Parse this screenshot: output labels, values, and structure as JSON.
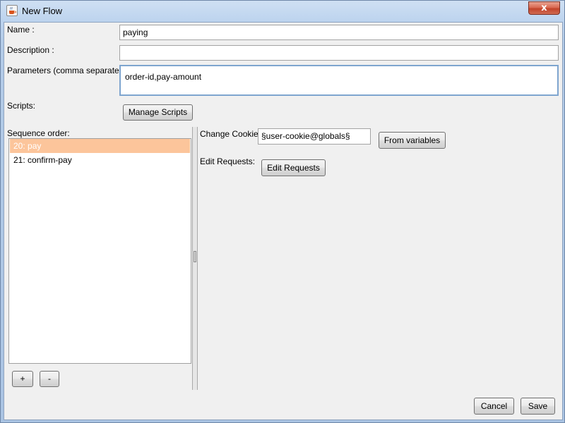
{
  "window": {
    "title": "New Flow",
    "close_symbol": "x",
    "title_icon": "java-cup-icon"
  },
  "form": {
    "name_label": "Name :",
    "name_value": "paying",
    "description_label": "Description :",
    "description_value": "",
    "parameters_label": "Parameters (comma separated):",
    "parameters_value": "order-id,pay-amount",
    "scripts_label": "Scripts:",
    "manage_scripts_button": "Manage Scripts"
  },
  "sequence": {
    "label": "Sequence order:",
    "items": [
      {
        "label": "20: pay",
        "selected": true
      },
      {
        "label": "21: confirm-pay",
        "selected": false
      }
    ],
    "add_button": "+",
    "remove_button": "-"
  },
  "details": {
    "change_cookie_label": "Change Cookie:",
    "cookie_value": "§user-cookie@globals§",
    "from_variables_button": "From variables",
    "edit_requests_label": "Edit Requests:",
    "edit_requests_button": "Edit Requests"
  },
  "footer": {
    "cancel_button": "Cancel",
    "save_button": "Save"
  },
  "colors": {
    "selection": "#fcc59b",
    "close_button": "#c2442a",
    "focus_border": "#7ea5cf"
  }
}
